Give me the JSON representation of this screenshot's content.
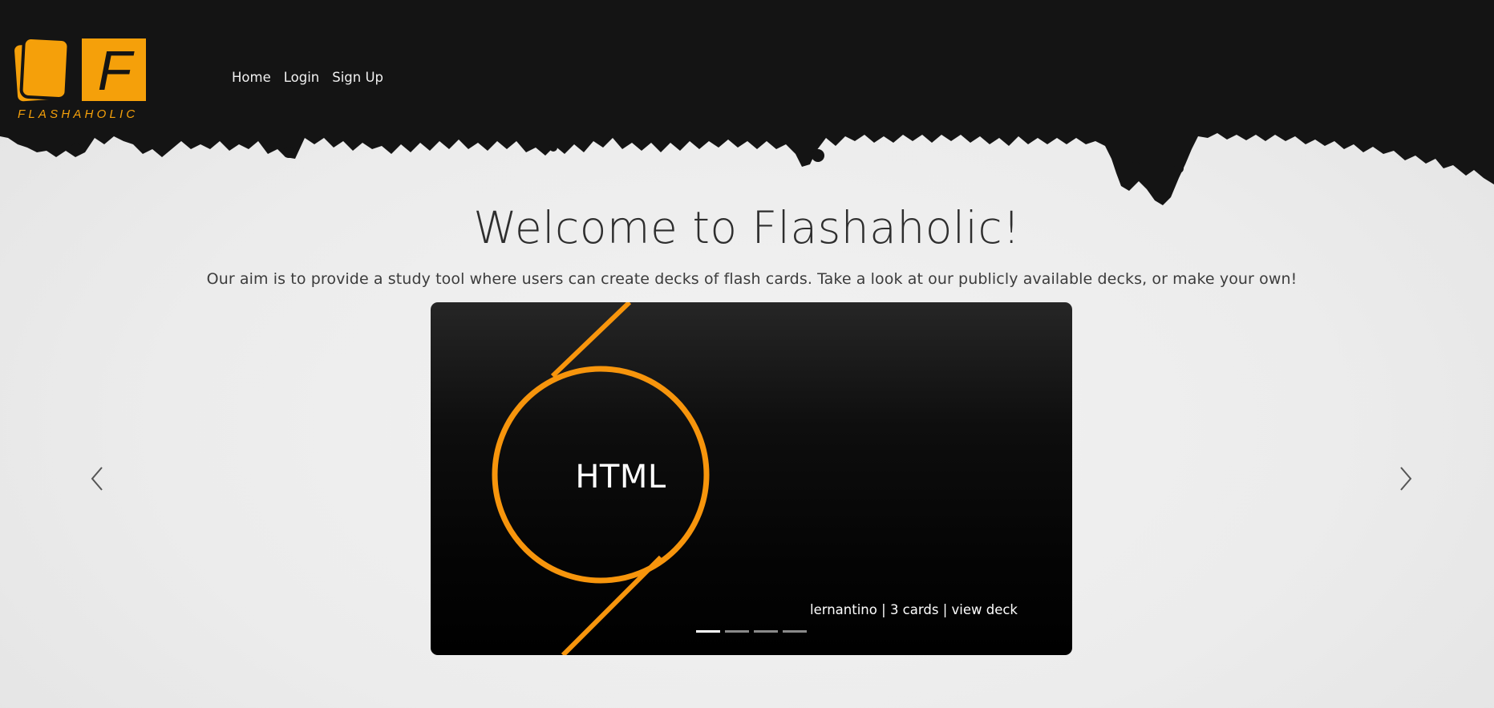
{
  "brand": {
    "logo_letter": "F",
    "name": "FLASHAHOLIC"
  },
  "nav": {
    "items": [
      {
        "label": "Home"
      },
      {
        "label": "Login"
      },
      {
        "label": "Sign Up"
      }
    ]
  },
  "hero": {
    "title": "Welcome to Flashaholic!",
    "subtitle": "Our aim is to provide a study tool where users can create decks of flash cards. Take a look at our publicly available decks, or make your own!"
  },
  "carousel": {
    "slide": {
      "title": "HTML",
      "author": "lernantino",
      "cards": "3 cards",
      "link": "view deck",
      "separator": "|"
    },
    "active_index": 0,
    "slide_count": 4,
    "prev_icon": "chevron-left-icon",
    "next_icon": "chevron-right-icon"
  },
  "colors": {
    "accent": "#f5a00a",
    "header": "#141414",
    "text": "#2e2e2e"
  }
}
